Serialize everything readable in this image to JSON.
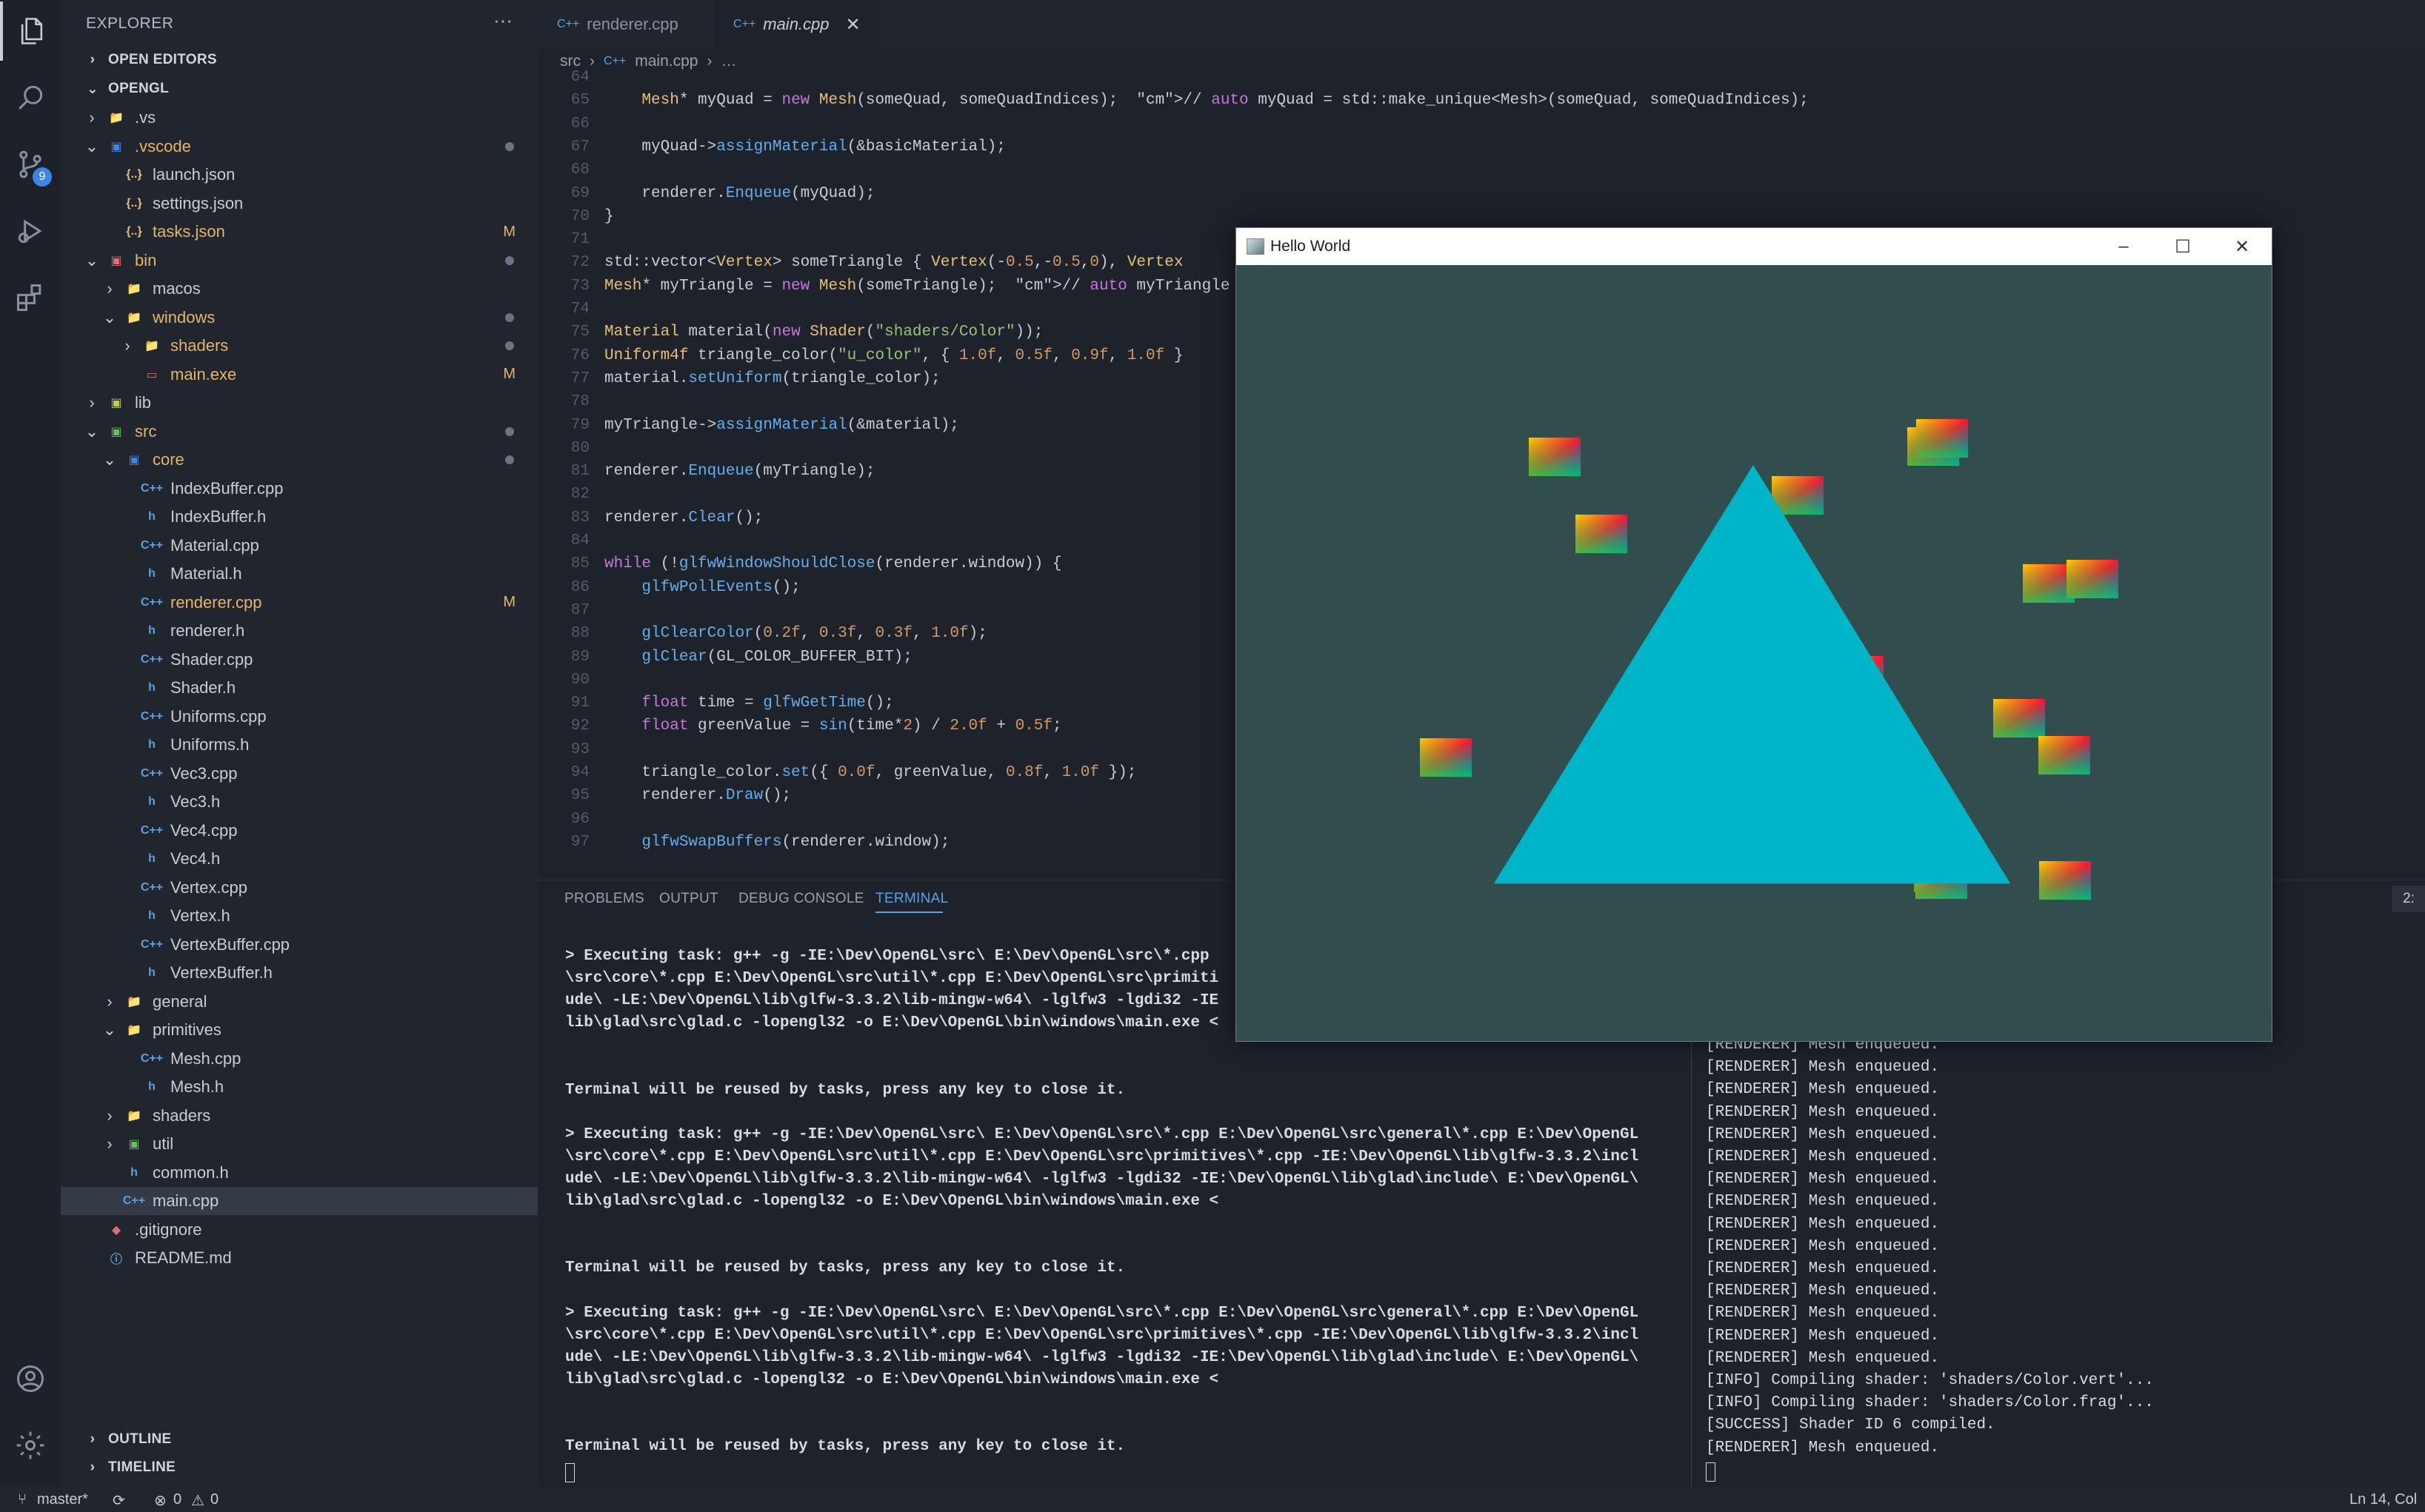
{
  "explorer": {
    "title": "EXPLORER",
    "more": "···",
    "open_editors": "OPEN EDITORS",
    "root": "OPENGL",
    "tree": [
      {
        "label": ".vs",
        "depth": 1,
        "kind": "folder",
        "open": false
      },
      {
        "label": ".vscode",
        "depth": 1,
        "kind": "folder-vscode",
        "open": true,
        "modified": true,
        "dot": true
      },
      {
        "label": "launch.json",
        "depth": 2,
        "kind": "json"
      },
      {
        "label": "settings.json",
        "depth": 2,
        "kind": "json"
      },
      {
        "label": "tasks.json",
        "depth": 2,
        "kind": "json",
        "modified": true,
        "mark": "M"
      },
      {
        "label": "bin",
        "depth": 1,
        "kind": "folder-red",
        "open": true,
        "modified": true,
        "dot": true
      },
      {
        "label": "macos",
        "depth": 2,
        "kind": "folder",
        "open": false
      },
      {
        "label": "windows",
        "depth": 2,
        "kind": "folder",
        "open": true,
        "modified": true,
        "dot": true
      },
      {
        "label": "shaders",
        "depth": 3,
        "kind": "folder",
        "open": false,
        "modified": true,
        "dot": true
      },
      {
        "label": "main.exe",
        "depth": 3,
        "kind": "exe",
        "modified": true,
        "mark": "M"
      },
      {
        "label": "lib",
        "depth": 1,
        "kind": "folder-lib",
        "open": false
      },
      {
        "label": "src",
        "depth": 1,
        "kind": "folder-src",
        "open": true,
        "modified": true,
        "dot": true
      },
      {
        "label": "core",
        "depth": 2,
        "kind": "folder-core",
        "open": true,
        "modified": true,
        "dot": true
      },
      {
        "label": "IndexBuffer.cpp",
        "depth": 3,
        "kind": "cpp"
      },
      {
        "label": "IndexBuffer.h",
        "depth": 3,
        "kind": "h"
      },
      {
        "label": "Material.cpp",
        "depth": 3,
        "kind": "cpp"
      },
      {
        "label": "Material.h",
        "depth": 3,
        "kind": "h"
      },
      {
        "label": "renderer.cpp",
        "depth": 3,
        "kind": "cpp",
        "modified": true,
        "mark": "M"
      },
      {
        "label": "renderer.h",
        "depth": 3,
        "kind": "h"
      },
      {
        "label": "Shader.cpp",
        "depth": 3,
        "kind": "cpp"
      },
      {
        "label": "Shader.h",
        "depth": 3,
        "kind": "h"
      },
      {
        "label": "Uniforms.cpp",
        "depth": 3,
        "kind": "cpp"
      },
      {
        "label": "Uniforms.h",
        "depth": 3,
        "kind": "h"
      },
      {
        "label": "Vec3.cpp",
        "depth": 3,
        "kind": "cpp"
      },
      {
        "label": "Vec3.h",
        "depth": 3,
        "kind": "h"
      },
      {
        "label": "Vec4.cpp",
        "depth": 3,
        "kind": "cpp"
      },
      {
        "label": "Vec4.h",
        "depth": 3,
        "kind": "h"
      },
      {
        "label": "Vertex.cpp",
        "depth": 3,
        "kind": "cpp"
      },
      {
        "label": "Vertex.h",
        "depth": 3,
        "kind": "h"
      },
      {
        "label": "VertexBuffer.cpp",
        "depth": 3,
        "kind": "cpp"
      },
      {
        "label": "VertexBuffer.h",
        "depth": 3,
        "kind": "h"
      },
      {
        "label": "general",
        "depth": 2,
        "kind": "folder",
        "open": false
      },
      {
        "label": "primitives",
        "depth": 2,
        "kind": "folder",
        "open": true
      },
      {
        "label": "Mesh.cpp",
        "depth": 3,
        "kind": "cpp"
      },
      {
        "label": "Mesh.h",
        "depth": 3,
        "kind": "h"
      },
      {
        "label": "shaders",
        "depth": 2,
        "kind": "folder",
        "open": false
      },
      {
        "label": "util",
        "depth": 2,
        "kind": "folder-util",
        "open": false
      },
      {
        "label": "common.h",
        "depth": 2,
        "kind": "h"
      },
      {
        "label": "main.cpp",
        "depth": 2,
        "kind": "cpp",
        "selected": true
      },
      {
        "label": ".gitignore",
        "depth": 1,
        "kind": "git"
      },
      {
        "label": "README.md",
        "depth": 1,
        "kind": "info"
      }
    ],
    "outline": "OUTLINE",
    "timeline": "TIMELINE"
  },
  "activity": {
    "scm_badge": "9"
  },
  "tabs": [
    {
      "label": "renderer.cpp",
      "active": false
    },
    {
      "label": "main.cpp",
      "active": true
    }
  ],
  "tab_close": "✕",
  "breadcrumb": {
    "folder": "src",
    "sep": "›",
    "file": "main.cpp",
    "more": "…"
  },
  "code": {
    "line_numbers": [
      "64",
      "65",
      "66",
      "67",
      "68",
      "69",
      "70",
      "71",
      "72",
      "73",
      "74",
      "75",
      "76",
      "77",
      "78",
      "79",
      "80",
      "81",
      "82",
      "83",
      "84",
      "85",
      "86",
      "87",
      "88",
      "89",
      "90",
      "91",
      "92",
      "93",
      "94",
      "95",
      "96",
      "97"
    ],
    "lines": [
      "",
      "    Mesh* myQuad = new Mesh(someQuad, someQuadIndices);  // auto myQuad = std::make_unique<Mesh>(someQuad, someQuadIndices);",
      "",
      "    myQuad->assignMaterial(&basicMaterial);",
      "",
      "    renderer.Enqueue(myQuad);",
      "}",
      "",
      "std::vector<Vertex> someTriangle { Vertex(-0.5,-0.5,0), Vertex",
      "Mesh* myTriangle = new Mesh(someTriangle);  // auto myTriangle",
      "",
      "Material material(new Shader(\"shaders/Color\"));",
      "Uniform4f triangle_color(\"u_color\", { 1.0f, 0.5f, 0.9f, 1.0f }",
      "material.setUniform(triangle_color);",
      "",
      "myTriangle->assignMaterial(&material);",
      "",
      "renderer.Enqueue(myTriangle);",
      "",
      "renderer.Clear();",
      "",
      "while (!glfwWindowShouldClose(renderer.window)) {",
      "    glfwPollEvents();",
      "",
      "    glClearColor(0.2f, 0.3f, 0.3f, 1.0f);",
      "    glClear(GL_COLOR_BUFFER_BIT);",
      "",
      "    float time = glfwGetTime();",
      "    float greenValue = sin(time*2) / 2.0f + 0.5f;",
      "",
      "    triangle_color.set({ 0.0f, greenValue, 0.8f, 1.0f });",
      "    renderer.Draw();",
      "",
      "    glfwSwapBuffers(renderer.window);"
    ]
  },
  "panel": {
    "tabs": [
      "PROBLEMS",
      "OUTPUT",
      "DEBUG CONSOLE",
      "TERMINAL"
    ],
    "active_tab": "TERMINAL",
    "terminal_number": "2:",
    "left_terminal": [
      "> Executing task: g++ -g -IE:\\Dev\\OpenGL\\src\\ E:\\Dev\\OpenGL\\src\\*.cpp",
      "\\src\\core\\*.cpp E:\\Dev\\OpenGL\\src\\util\\*.cpp E:\\Dev\\OpenGL\\src\\primiti",
      "ude\\ -LE:\\Dev\\OpenGL\\lib\\glfw-3.3.2\\lib-mingw-w64\\ -lglfw3 -lgdi32 -IE",
      "lib\\glad\\src\\glad.c -lopengl32 -o E:\\Dev\\OpenGL\\bin\\windows\\main.exe <",
      "",
      "",
      "Terminal will be reused by tasks, press any key to close it.",
      "",
      "> Executing task: g++ -g -IE:\\Dev\\OpenGL\\src\\ E:\\Dev\\OpenGL\\src\\*.cpp E:\\Dev\\OpenGL\\src\\general\\*.cpp E:\\Dev\\OpenGL",
      "\\src\\core\\*.cpp E:\\Dev\\OpenGL\\src\\util\\*.cpp E:\\Dev\\OpenGL\\src\\primitives\\*.cpp -IE:\\Dev\\OpenGL\\lib\\glfw-3.3.2\\incl",
      "ude\\ -LE:\\Dev\\OpenGL\\lib\\glfw-3.3.2\\lib-mingw-w64\\ -lglfw3 -lgdi32 -IE:\\Dev\\OpenGL\\lib\\glad\\include\\ E:\\Dev\\OpenGL\\",
      "lib\\glad\\src\\glad.c -lopengl32 -o E:\\Dev\\OpenGL\\bin\\windows\\main.exe <",
      "",
      "",
      "Terminal will be reused by tasks, press any key to close it.",
      "",
      "> Executing task: g++ -g -IE:\\Dev\\OpenGL\\src\\ E:\\Dev\\OpenGL\\src\\*.cpp E:\\Dev\\OpenGL\\src\\general\\*.cpp E:\\Dev\\OpenGL",
      "\\src\\core\\*.cpp E:\\Dev\\OpenGL\\src\\util\\*.cpp E:\\Dev\\OpenGL\\src\\primitives\\*.cpp -IE:\\Dev\\OpenGL\\lib\\glfw-3.3.2\\incl",
      "ude\\ -LE:\\Dev\\OpenGL\\lib\\glfw-3.3.2\\lib-mingw-w64\\ -lglfw3 -lgdi32 -IE:\\Dev\\OpenGL\\lib\\glad\\include\\ E:\\Dev\\OpenGL\\",
      "lib\\glad\\src\\glad.c -lopengl32 -o E:\\Dev\\OpenGL\\bin\\windows\\main.exe <",
      "",
      "",
      "Terminal will be reused by tasks, press any key to close it."
    ],
    "right_terminal": [
      "[RENDERER] Mesh enqueued.",
      "[RENDERER] Mesh enqueued.",
      "[RENDERER] Mesh enqueued.",
      "[RENDERER] Mesh enqueued.",
      "[RENDERER] Mesh enqueued.",
      "[RENDERER] Mesh enqueued.",
      "[RENDERER] Mesh enqueued.",
      "[RENDERER] Mesh enqueued.",
      "[RENDERER] Mesh enqueued.",
      "[RENDERER] Mesh enqueued.",
      "[RENDERER] Mesh enqueued.",
      "[RENDERER] Mesh enqueued.",
      "[RENDERER] Mesh enqueued.",
      "[RENDERER] Mesh enqueued.",
      "[RENDERER] Mesh enqueued.",
      "[INFO] Compiling shader: 'shaders/Color.vert'...",
      "[INFO] Compiling shader: 'shaders/Color.frag'...",
      "[SUCCESS] Shader ID 6 compiled.",
      "[RENDERER] Mesh enqueued."
    ]
  },
  "app_window": {
    "title": "Hello World",
    "minimize": "–",
    "maximize": "☐",
    "close": "✕",
    "clear_color": "#324d4d",
    "triangle_color": "#00b5c8"
  },
  "status": {
    "branch": "master*",
    "sync": "⟳",
    "errors": "0",
    "warnings": "0",
    "position": "Ln 14, Col"
  }
}
